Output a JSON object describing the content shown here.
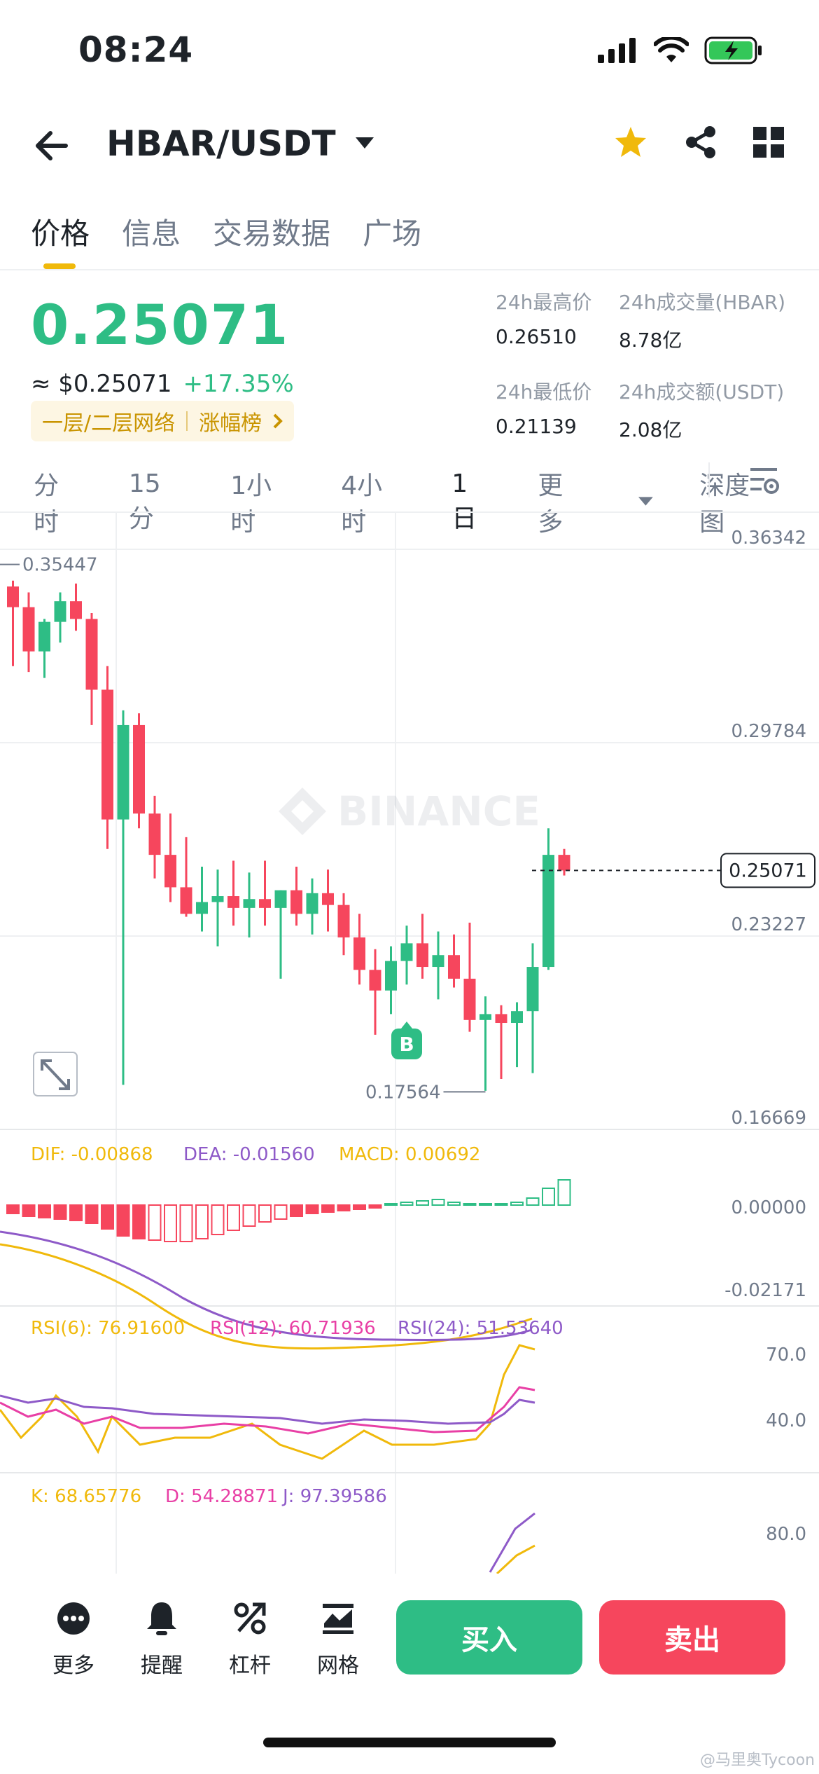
{
  "status_bar": {
    "time": "08:24"
  },
  "header": {
    "pair": "HBAR/USDT"
  },
  "tabs": [
    {
      "label": "价格",
      "active": true
    },
    {
      "label": "信息"
    },
    {
      "label": "交易数据"
    },
    {
      "label": "广场"
    }
  ],
  "price": {
    "last": "0.25071",
    "usd": "≈ $0.25071",
    "change": "+17.35%",
    "tag1": "一层/二层网络",
    "tag2": "涨幅榜"
  },
  "stats": {
    "high_label": "24h最高价",
    "high": "0.26510",
    "vol_label": "24h成交量(HBAR)",
    "vol": "8.78亿",
    "low_label": "24h最低价",
    "low": "0.21139",
    "turnover_label": "24h成交额(USDT)",
    "turnover": "2.08亿"
  },
  "intervals": [
    "分时",
    "15分",
    "1小时",
    "4小时",
    "1日",
    "更多",
    "深度图"
  ],
  "chart_data": {
    "type": "candlestick",
    "watermark": "BINANCE",
    "y_axis_ticks": [
      "0.36342",
      "0.29784",
      "0.23227",
      "0.16669"
    ],
    "current_price_label": "0.25071",
    "max_marker": "0.35447",
    "min_marker": "0.17564",
    "trade_marker": "B",
    "candles_ohlc": [
      [
        0.347,
        0.349,
        0.32,
        0.34
      ],
      [
        0.34,
        0.345,
        0.318,
        0.325
      ],
      [
        0.325,
        0.336,
        0.316,
        0.335
      ],
      [
        0.335,
        0.345,
        0.328,
        0.342
      ],
      [
        0.342,
        0.348,
        0.332,
        0.336
      ],
      [
        0.336,
        0.338,
        0.3,
        0.312
      ],
      [
        0.312,
        0.32,
        0.258,
        0.268
      ],
      [
        0.268,
        0.305,
        0.178,
        0.3
      ],
      [
        0.3,
        0.304,
        0.265,
        0.27
      ],
      [
        0.27,
        0.276,
        0.248,
        0.256
      ],
      [
        0.256,
        0.27,
        0.24,
        0.245
      ],
      [
        0.245,
        0.262,
        0.235,
        0.236
      ],
      [
        0.236,
        0.252,
        0.23,
        0.24
      ],
      [
        0.24,
        0.251,
        0.225,
        0.242
      ],
      [
        0.242,
        0.254,
        0.232,
        0.238
      ],
      [
        0.238,
        0.25,
        0.228,
        0.241
      ],
      [
        0.241,
        0.254,
        0.232,
        0.238
      ],
      [
        0.238,
        0.244,
        0.214,
        0.244
      ],
      [
        0.244,
        0.252,
        0.232,
        0.236
      ],
      [
        0.236,
        0.248,
        0.229,
        0.243
      ],
      [
        0.243,
        0.251,
        0.23,
        0.239
      ],
      [
        0.239,
        0.243,
        0.222,
        0.228
      ],
      [
        0.228,
        0.236,
        0.212,
        0.217
      ],
      [
        0.217,
        0.224,
        0.195,
        0.21
      ],
      [
        0.21,
        0.225,
        0.202,
        0.22
      ],
      [
        0.22,
        0.232,
        0.212,
        0.226
      ],
      [
        0.226,
        0.236,
        0.214,
        0.218
      ],
      [
        0.218,
        0.23,
        0.207,
        0.222
      ],
      [
        0.222,
        0.229,
        0.211,
        0.214
      ],
      [
        0.214,
        0.233,
        0.196,
        0.2
      ],
      [
        0.2,
        0.208,
        0.176,
        0.202
      ],
      [
        0.202,
        0.205,
        0.18,
        0.199
      ],
      [
        0.199,
        0.206,
        0.184,
        0.203
      ],
      [
        0.203,
        0.226,
        0.182,
        0.218
      ],
      [
        0.218,
        0.265,
        0.217,
        0.256
      ],
      [
        0.256,
        0.258,
        0.249,
        0.25071
      ]
    ],
    "macd": {
      "dif_label": "DIF: -0.00868",
      "dea_label": "DEA: -0.01560",
      "macd_label": "MACD: 0.00692",
      "axis_ticks": [
        "0.00000",
        "-0.02171"
      ]
    },
    "rsi": {
      "rsi6_label": "RSI(6): 76.91600",
      "rsi12_label": "RSI(12): 60.71936",
      "rsi24_label": "RSI(24): 51.53640",
      "axis_ticks": [
        "70.0",
        "40.0"
      ]
    },
    "kdj": {
      "k_label": "K: 68.65776",
      "d_label": "D: 54.28871",
      "j_label": "J: 97.39586",
      "axis_ticks": [
        "80.0"
      ]
    }
  },
  "bottom_bar": {
    "more": "更多",
    "alert": "提醒",
    "leverage": "杠杆",
    "grid": "网格",
    "buy": "买入",
    "sell": "卖出"
  },
  "footer": {
    "watermark": "@马里奥Tycoon"
  },
  "colors": {
    "up": "#2ebd85",
    "down": "#f6465d",
    "accent": "#f0b90b"
  }
}
